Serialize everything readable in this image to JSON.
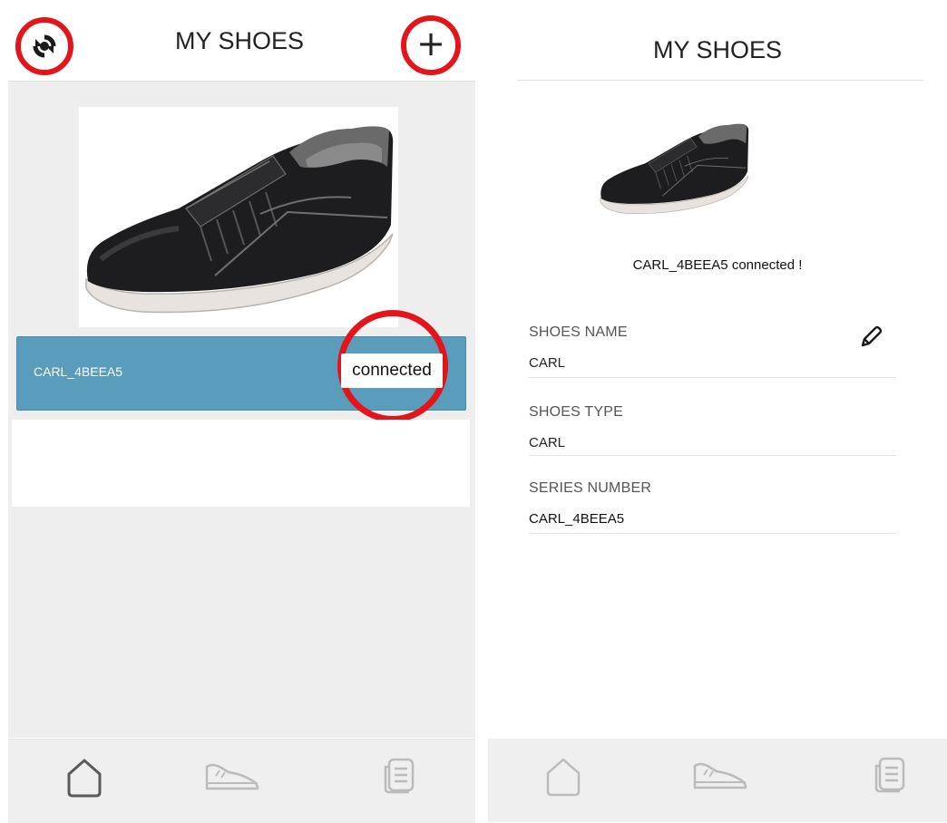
{
  "left_screen": {
    "title": "MY SHOES",
    "toolbar": {
      "refresh_icon": "refresh-icon",
      "add_icon": "plus-icon",
      "add_label": "+"
    },
    "shoe_list": [
      {
        "name": "CARL_4BEEA5",
        "status": "connected"
      }
    ],
    "tabs": [
      {
        "icon": "home-icon",
        "active": true
      },
      {
        "icon": "shoe-icon",
        "active": false
      },
      {
        "icon": "records-icon",
        "active": false
      }
    ]
  },
  "right_screen": {
    "title": "MY SHOES",
    "connection_message": "CARL_4BEEA5 connected !",
    "fields": {
      "shoes_name": {
        "label": "SHOES NAME",
        "value": "CARL",
        "edit_icon": "pencil-icon"
      },
      "shoes_type": {
        "label": "SHOES TYPE",
        "value": "CARL"
      },
      "series_number": {
        "label": "SERIES NUMBER",
        "value": "CARL_4BEEA5"
      }
    },
    "tabs": [
      {
        "icon": "home-icon",
        "active": false
      },
      {
        "icon": "shoe-icon",
        "active": false
      },
      {
        "icon": "records-icon",
        "active": false
      }
    ]
  },
  "colors": {
    "highlight_ring": "#e4141b",
    "selected_row": "#5a9cbb",
    "list_background": "#eeeeee"
  }
}
